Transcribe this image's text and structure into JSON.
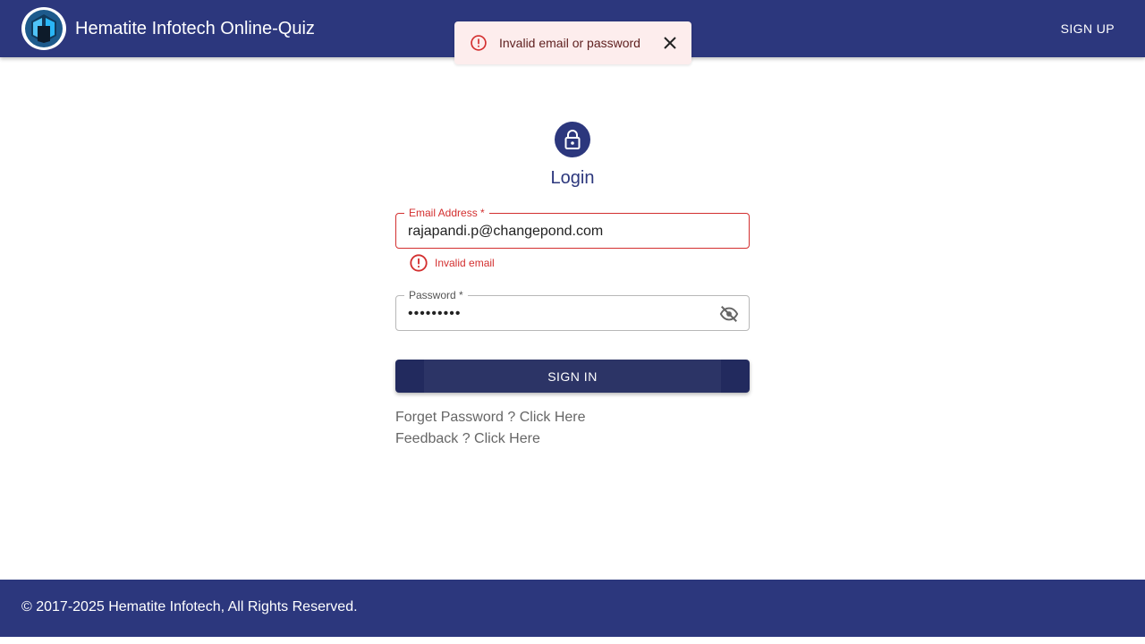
{
  "header": {
    "title": "Hematite Infotech Online-Quiz",
    "signup_label": "SIGN UP",
    "logo_icon": "hexagon-logo-icon"
  },
  "alert": {
    "message": "Invalid email or password",
    "severity": "error",
    "icon": "error-outline-icon",
    "close_icon": "close-icon"
  },
  "login": {
    "icon": "lock-icon",
    "title": "Login",
    "email": {
      "label": "Email Address *",
      "value": "rajapandi.p@changepond.com",
      "error": "Invalid email"
    },
    "password": {
      "label": "Password *",
      "value": "•••••••••",
      "toggle_icon": "visibility-off-icon"
    },
    "signin_label": "SIGN IN",
    "forget_password": "Forget Password ? Click Here",
    "feedback": "Feedback ? Click Here"
  },
  "footer": {
    "copyright": "© 2017-2025 Hematite Infotech, All Rights Reserved."
  },
  "colors": {
    "primary": "#2c377d",
    "error": "#d32f2f",
    "alert_bg": "#fdeded",
    "alert_text": "#5f2120"
  }
}
